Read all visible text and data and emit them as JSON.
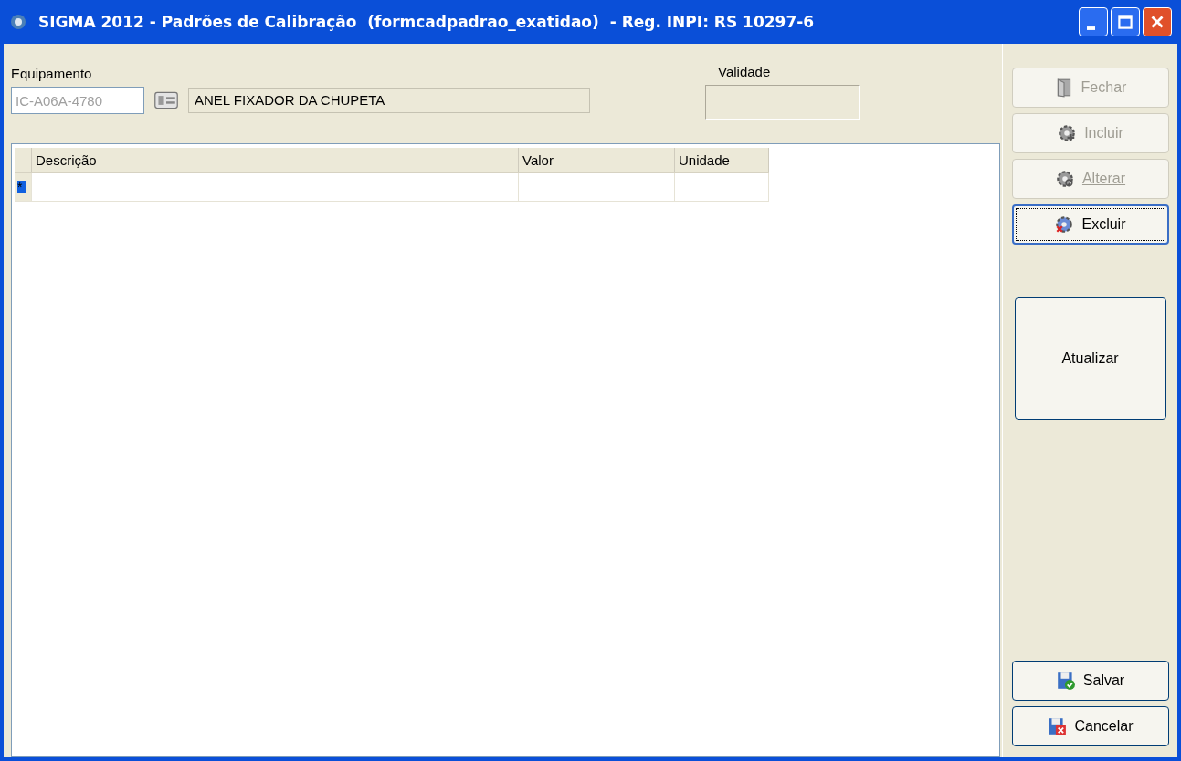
{
  "window": {
    "title": "SIGMA 2012 - Padrões de Calibração  (formcadpadrao_exatidao)  - Reg. INPI: RS 10297-6"
  },
  "equipamento": {
    "label": "Equipamento",
    "code": "IC-A06A-4780",
    "code_disabled": true,
    "description": "ANEL FIXADOR DA CHUPETA"
  },
  "validade": {
    "label": "Validade"
  },
  "grid": {
    "columns": [
      "Descrição",
      "Valor",
      "Unidade"
    ],
    "new_row_marker": "*"
  },
  "action_buttons": [
    {
      "label": "Fechar",
      "kind": "door",
      "disabled": true,
      "focused": false,
      "underlined": false
    },
    {
      "label": "Incluir",
      "kind": "gear-plus",
      "disabled": true,
      "focused": false,
      "underlined": false
    },
    {
      "label": "Alterar",
      "kind": "gear-edit",
      "disabled": true,
      "focused": false,
      "underlined": true
    },
    {
      "label": "Excluir",
      "kind": "gear-delete",
      "disabled": false,
      "focused": true,
      "underlined": false
    }
  ],
  "refresh_button": {
    "label": "Atualizar"
  },
  "bottom_buttons": [
    {
      "label": "Salvar",
      "kind": "save"
    },
    {
      "label": "Cancelar",
      "kind": "cancel"
    }
  ]
}
